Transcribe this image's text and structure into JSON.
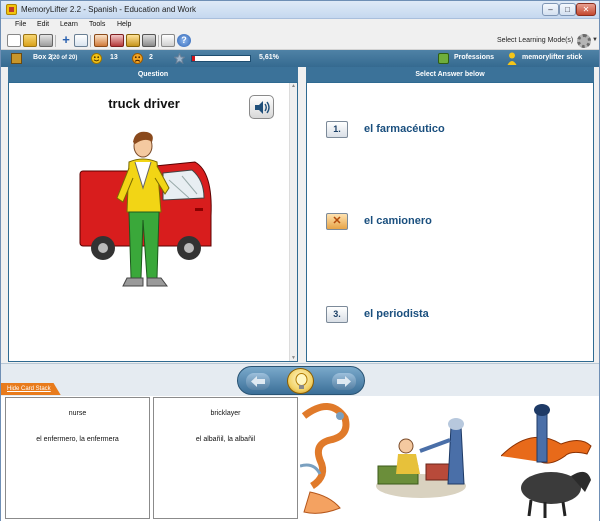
{
  "window": {
    "title": "MemoryLifter 2.2 - Spanish - Education and Work",
    "min_glyph": "–",
    "max_glyph": "□",
    "close_glyph": "✕"
  },
  "menu": {
    "items": [
      "File",
      "Edit",
      "Learn",
      "Tools",
      "Help"
    ]
  },
  "toolbar": {
    "select_mode_label": "Select Learning Mode(s)",
    "mode_caret": "▼"
  },
  "status": {
    "box_label": "Box 2",
    "box_count": "(20 of 20)",
    "correct_count": "13",
    "wrong_count": "2",
    "progress_fraction": 0.0561,
    "progress_label": "5,61%",
    "chapter": "Professions",
    "user": "memorylifter stick"
  },
  "question_panel": {
    "header": "Question",
    "word": "truck driver"
  },
  "answer_panel": {
    "header": "Select Answer below",
    "options": [
      {
        "marker": "1.",
        "text": "el farmacéutico",
        "state": "normal"
      },
      {
        "marker": "✕",
        "text": "el camionero",
        "state": "wrong"
      },
      {
        "marker": "3.",
        "text": "el periodista",
        "state": "normal"
      }
    ]
  },
  "nav": {
    "hide_stack_label": "Hide Card Stack"
  },
  "card_stack": [
    {
      "question": "nurse",
      "answer": "el enfermero, la enfermera"
    },
    {
      "question": "bricklayer",
      "answer": "el albañil, la albañil"
    }
  ],
  "colors": {
    "accent_blue": "#3b7299",
    "answer_text": "#1a4f7e",
    "progress_fill": "#d0161b",
    "tab_orange": "#e87b1c"
  }
}
